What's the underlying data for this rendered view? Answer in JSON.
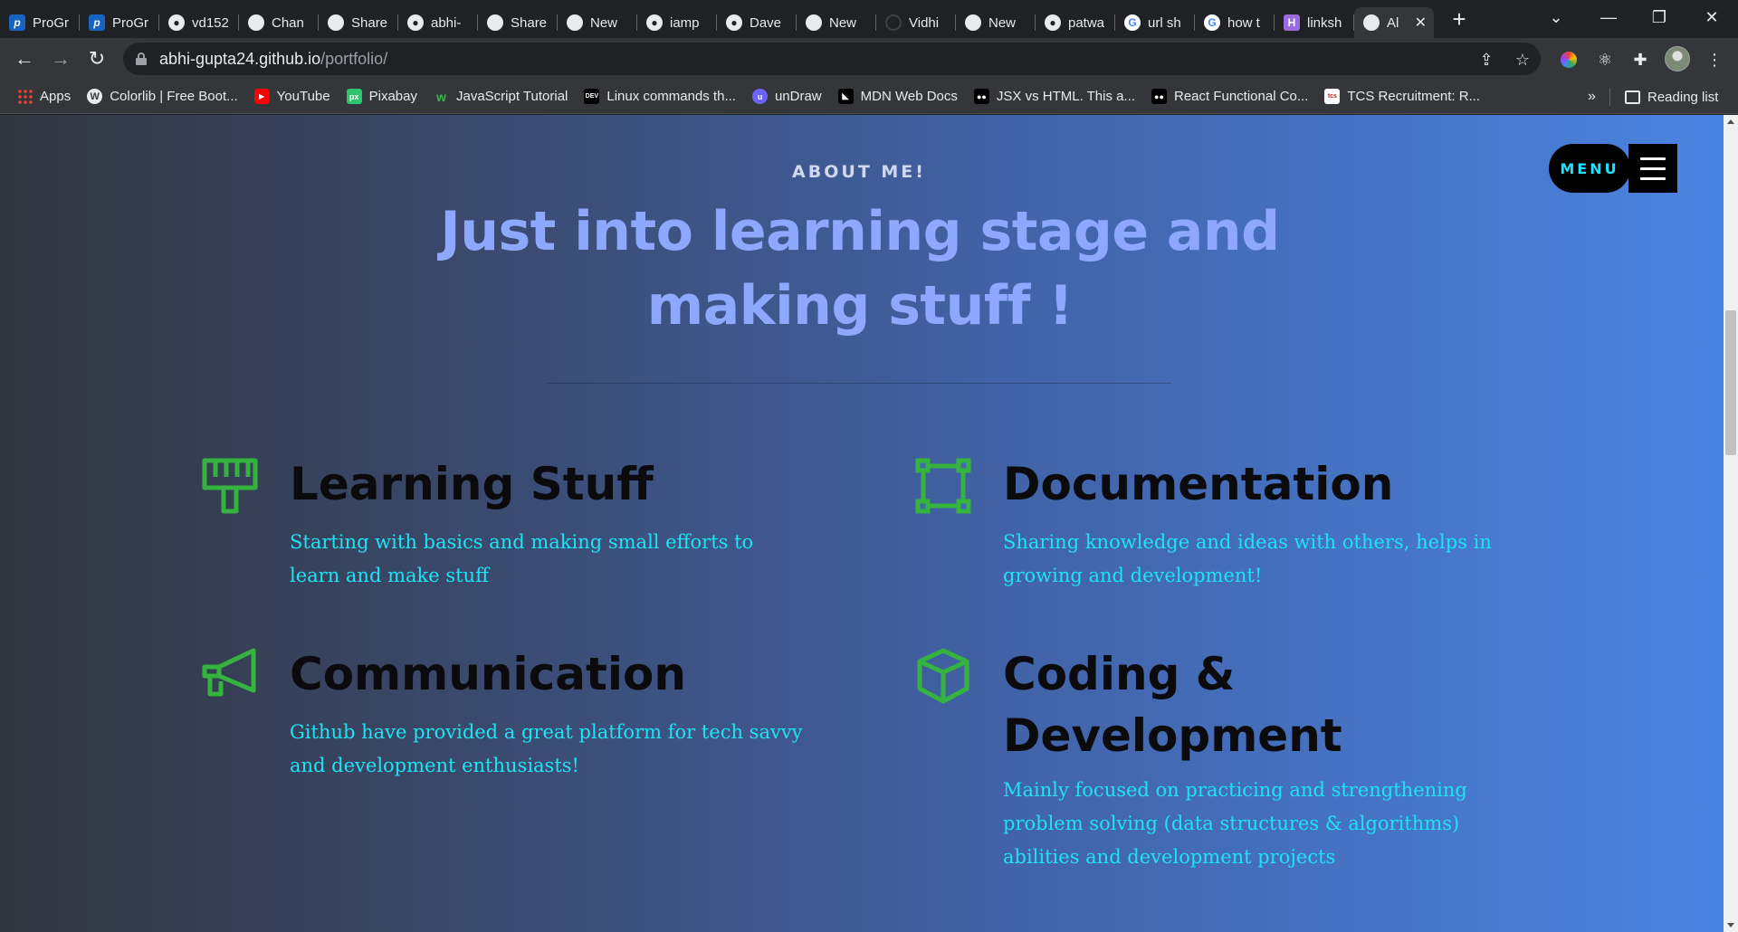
{
  "tabs": [
    {
      "label": "ProGr",
      "icon": "pg"
    },
    {
      "label": "ProGr",
      "icon": "pg"
    },
    {
      "label": "vd152",
      "icon": "github"
    },
    {
      "label": "Chan",
      "icon": "globe"
    },
    {
      "label": "Share",
      "icon": "globe"
    },
    {
      "label": "abhi-",
      "icon": "github"
    },
    {
      "label": "Share",
      "icon": "globe"
    },
    {
      "label": "New",
      "icon": "chrome"
    },
    {
      "label": "iamp",
      "icon": "github"
    },
    {
      "label": "Dave",
      "icon": "github"
    },
    {
      "label": "New",
      "icon": "chrome"
    },
    {
      "label": "Vidhi",
      "icon": "loading"
    },
    {
      "label": "New",
      "icon": "chrome"
    },
    {
      "label": "patwa",
      "icon": "github"
    },
    {
      "label": "url sh",
      "icon": "google"
    },
    {
      "label": "how t",
      "icon": "google"
    },
    {
      "label": "linksh",
      "icon": "hashnode"
    },
    {
      "label": "Al",
      "icon": "globe",
      "active": true
    }
  ],
  "toolbar": {
    "url_host": "abhi-gupta24.github.io",
    "url_path": "/portfolio/"
  },
  "bookmarks": [
    {
      "label": "Apps",
      "icon": "apps"
    },
    {
      "label": "Colorlib | Free Boot...",
      "icon": "wp",
      "glyph": "W"
    },
    {
      "label": "YouTube",
      "icon": "yt",
      "glyph": "▶"
    },
    {
      "label": "Pixabay",
      "icon": "px",
      "glyph": "px"
    },
    {
      "label": "JavaScript Tutorial",
      "icon": "jt",
      "glyph": "w"
    },
    {
      "label": "Linux commands th...",
      "icon": "dev",
      "glyph": "DEV"
    },
    {
      "label": "unDraw",
      "icon": "ud",
      "glyph": "u"
    },
    {
      "label": "MDN Web Docs",
      "icon": "mdn",
      "glyph": "◣"
    },
    {
      "label": "JSX vs HTML. This a...",
      "icon": "med",
      "glyph": "●●"
    },
    {
      "label": "React Functional Co...",
      "icon": "med",
      "glyph": "●●"
    },
    {
      "label": "TCS Recruitment: R...",
      "icon": "tcs",
      "glyph": "tcs"
    }
  ],
  "bookmarks_more": "»",
  "reading_list": "Reading list",
  "page": {
    "menu_label": "MENU",
    "eyebrow": "ABOUT ME!",
    "headline": "Just into learning stage and making stuff !",
    "features": [
      {
        "title": "Learning Stuff",
        "text": "Starting with basics and making small efforts to learn and make stuff",
        "icon": "paint-brush-icon"
      },
      {
        "title": "Documentation",
        "text": "Sharing knowledge and ideas with others, helps in growing and development!",
        "icon": "selection-frame-icon"
      },
      {
        "title": "Communication",
        "text": "Github have provided a great platform for tech savvy and development enthusiasts!",
        "icon": "megaphone-icon"
      },
      {
        "title": "Coding & Development",
        "text": "Mainly focused on practicing and strengthening problem solving (data structures & algorithms) abilities and development projects",
        "icon": "cube-icon"
      }
    ],
    "colors": {
      "icon_green": "#34b33e",
      "text_cyan": "#1fe3f3",
      "headline": "#8fa8ff"
    }
  }
}
